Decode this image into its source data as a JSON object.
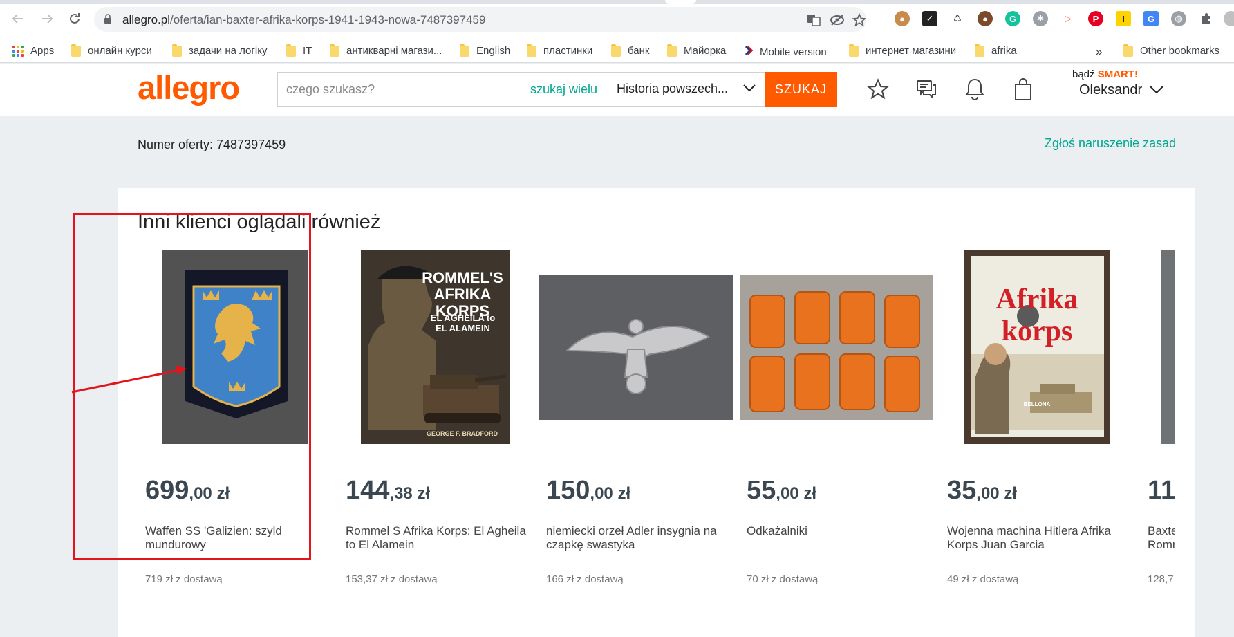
{
  "browser": {
    "url_domain": "allegro.pl",
    "url_path": "/oferta/ian-baxter-afrika-korps-1941-1943-nowa-7487397459",
    "bookmarks": [
      "Apps",
      "онлайн курси",
      "задачи на логіку",
      "IT",
      "антикварні магази...",
      "English",
      "пластинки",
      "банк",
      "Майорка",
      "Mobile version",
      "интернет магазини",
      "afrika"
    ],
    "more_label": "»",
    "other_bookmarks": "Other bookmarks"
  },
  "header": {
    "logo": "allegro",
    "search_placeholder": "czego szukasz?",
    "search_multi": "szukaj wielu",
    "category": "Historia powszech...",
    "search_button": "SZUKAJ",
    "smart_prefix": "bądź",
    "smart_label": "SMART!",
    "username": "Oleksandr"
  },
  "offer": {
    "number_label": "Numer oferty: 7487397459",
    "report_link": "Zgłoś naruszenie zasad"
  },
  "recommendations": {
    "title": "Inni klienci oglądali również",
    "items": [
      {
        "price_whole": "699",
        "price_frac": ",00 zł",
        "title": "Waffen SS 'Galizien: szyld mundurowy",
        "shipping": "719 zł z dostawą"
      },
      {
        "price_whole": "144",
        "price_frac": ",38 zł",
        "title": "Rommel S Afrika Korps: El Agheila to El Alamein",
        "shipping": "153,37 zł z dostawą",
        "cover_title": "ROMMEL'S AFRIKA KORPS",
        "cover_sub": "EL AGHEILA to EL ALAMEIN",
        "cover_author": "GEORGE F. BRADFORD"
      },
      {
        "price_whole": "150",
        "price_frac": ",00 zł",
        "title": "niemiecki orzeł Adler insygnia na czapkę swastyka",
        "shipping": "166 zł z dostawą"
      },
      {
        "price_whole": "55",
        "price_frac": ",00 zł",
        "title": "Odkażalniki",
        "shipping": "70 zł z dostawą"
      },
      {
        "price_whole": "35",
        "price_frac": ",00 zł",
        "title": "Wojenna machina Hitlera Afrika Korps Juan Garcia",
        "shipping": "49 zł z dostawą",
        "cover_title": "Afrika korps",
        "cover_publisher": "BELLONA"
      },
      {
        "price_whole": "11",
        "price_frac": "",
        "title": "Baxte Romr",
        "shipping": "128,7"
      }
    ]
  }
}
